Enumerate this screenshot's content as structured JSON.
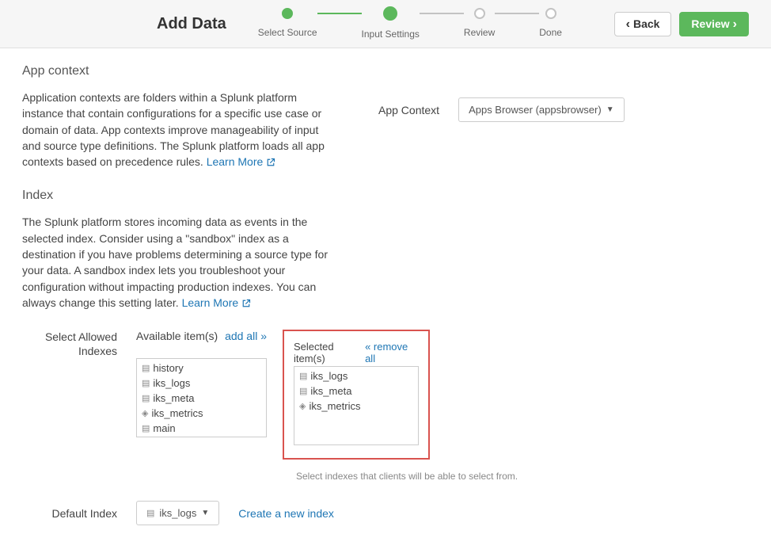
{
  "header": {
    "title": "Add Data",
    "steps": [
      {
        "label": "Select Source",
        "state": "done"
      },
      {
        "label": "Input Settings",
        "state": "active"
      },
      {
        "label": "Review",
        "state": ""
      },
      {
        "label": "Done",
        "state": ""
      }
    ],
    "back_label": "Back",
    "review_label": "Review"
  },
  "app_context": {
    "title": "App context",
    "desc": "Application contexts are folders within a Splunk platform instance that contain configurations for a specific use case or domain of data. App contexts improve manageability of input and source type definitions. The Splunk platform loads all app contexts based on precedence rules.",
    "learn_more": "Learn More",
    "form_label": "App Context",
    "selected": "Apps Browser (appsbrowser)"
  },
  "index": {
    "title": "Index",
    "desc": "The Splunk platform stores incoming data as events in the selected index. Consider using a \"sandbox\" index as a destination if you have problems determining a source type for your data. A sandbox index lets you troubleshoot your configuration without impacting production indexes. You can always change this setting later.",
    "learn_more": "Learn More",
    "select_allowed_label": "Select Allowed Indexes",
    "available_label": "Available item(s)",
    "add_all_label": "add all »",
    "selected_label": "Selected item(s)",
    "remove_all_label": "« remove all",
    "available_items": [
      "history",
      "iks_logs",
      "iks_meta",
      "iks_metrics",
      "main"
    ],
    "selected_items": [
      "iks_logs",
      "iks_meta",
      "iks_metrics"
    ],
    "helper": "Select indexes that clients will be able to select from.",
    "default_label": "Default Index",
    "default_value": "iks_logs",
    "create_label": "Create a new index"
  }
}
